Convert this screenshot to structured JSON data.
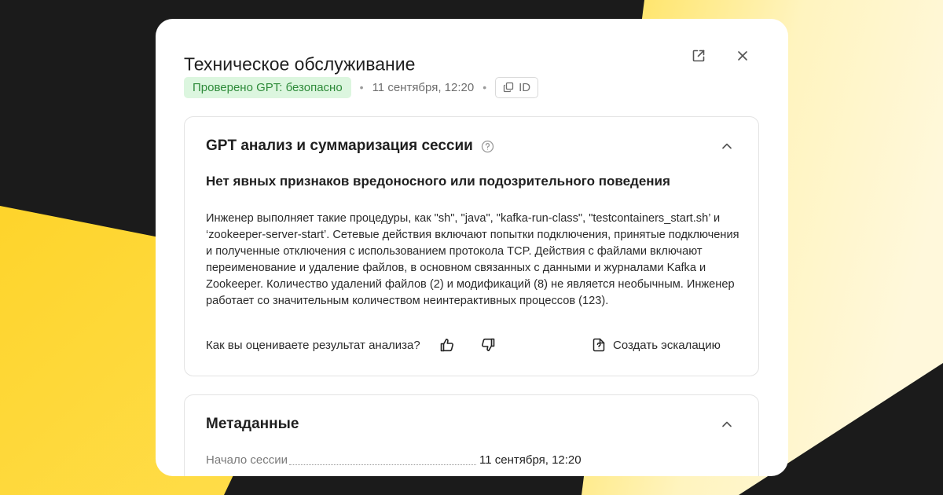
{
  "colors": {
    "background_dark": "#1b1b1b",
    "background_yellow": "#fed42b",
    "badge_bg": "#dcf6df",
    "badge_text": "#2e8b3a"
  },
  "modal": {
    "title": "Техническое обслуживание",
    "external_icon": "external-link-icon",
    "close_icon": "close-icon",
    "status_badge": "Проверено GPT: безопасно",
    "separator": "•",
    "date": "11 сентября, 12:20",
    "id_label": "ID",
    "id_icon": "copy-icon"
  },
  "analysis": {
    "title": "GPT анализ и суммаризация сессии",
    "help_icon": "help-circle-icon",
    "collapse_icon": "chevron-up-icon",
    "verdict": "Нет явных признаков вредоносного или подозрительного поведения",
    "summary": "Инженер выполняет такие процедуры, как \"sh\", \"java\", \"kafka-run-class\", \"testcontainers_start.sh’ и ‘zookeeper-server-start’. Сетевые действия включают попытки подключения, принятые подключения и полученные отключения с использованием протокола TCP. Действия с файлами включают переименование и удаление файлов, в основном связанных с данными и журналами Kafka и Zookeeper. Количество удалений файлов (2) и модификаций (8) не является необычным. Инженер работает со значительным количеством неинтерактивных процессов (123).",
    "feedback_question": "Как вы оцениваете результат анализа?",
    "like_icon": "thumbs-up-icon",
    "dislike_icon": "thumbs-down-icon",
    "escalate_icon": "file-question-icon",
    "escalate_label": "Создать эскалацию"
  },
  "metadata": {
    "title": "Метаданные",
    "collapse_icon": "chevron-up-icon",
    "fields": [
      {
        "key": "Начало сессии",
        "value": "11 сентября, 12:20"
      }
    ]
  }
}
